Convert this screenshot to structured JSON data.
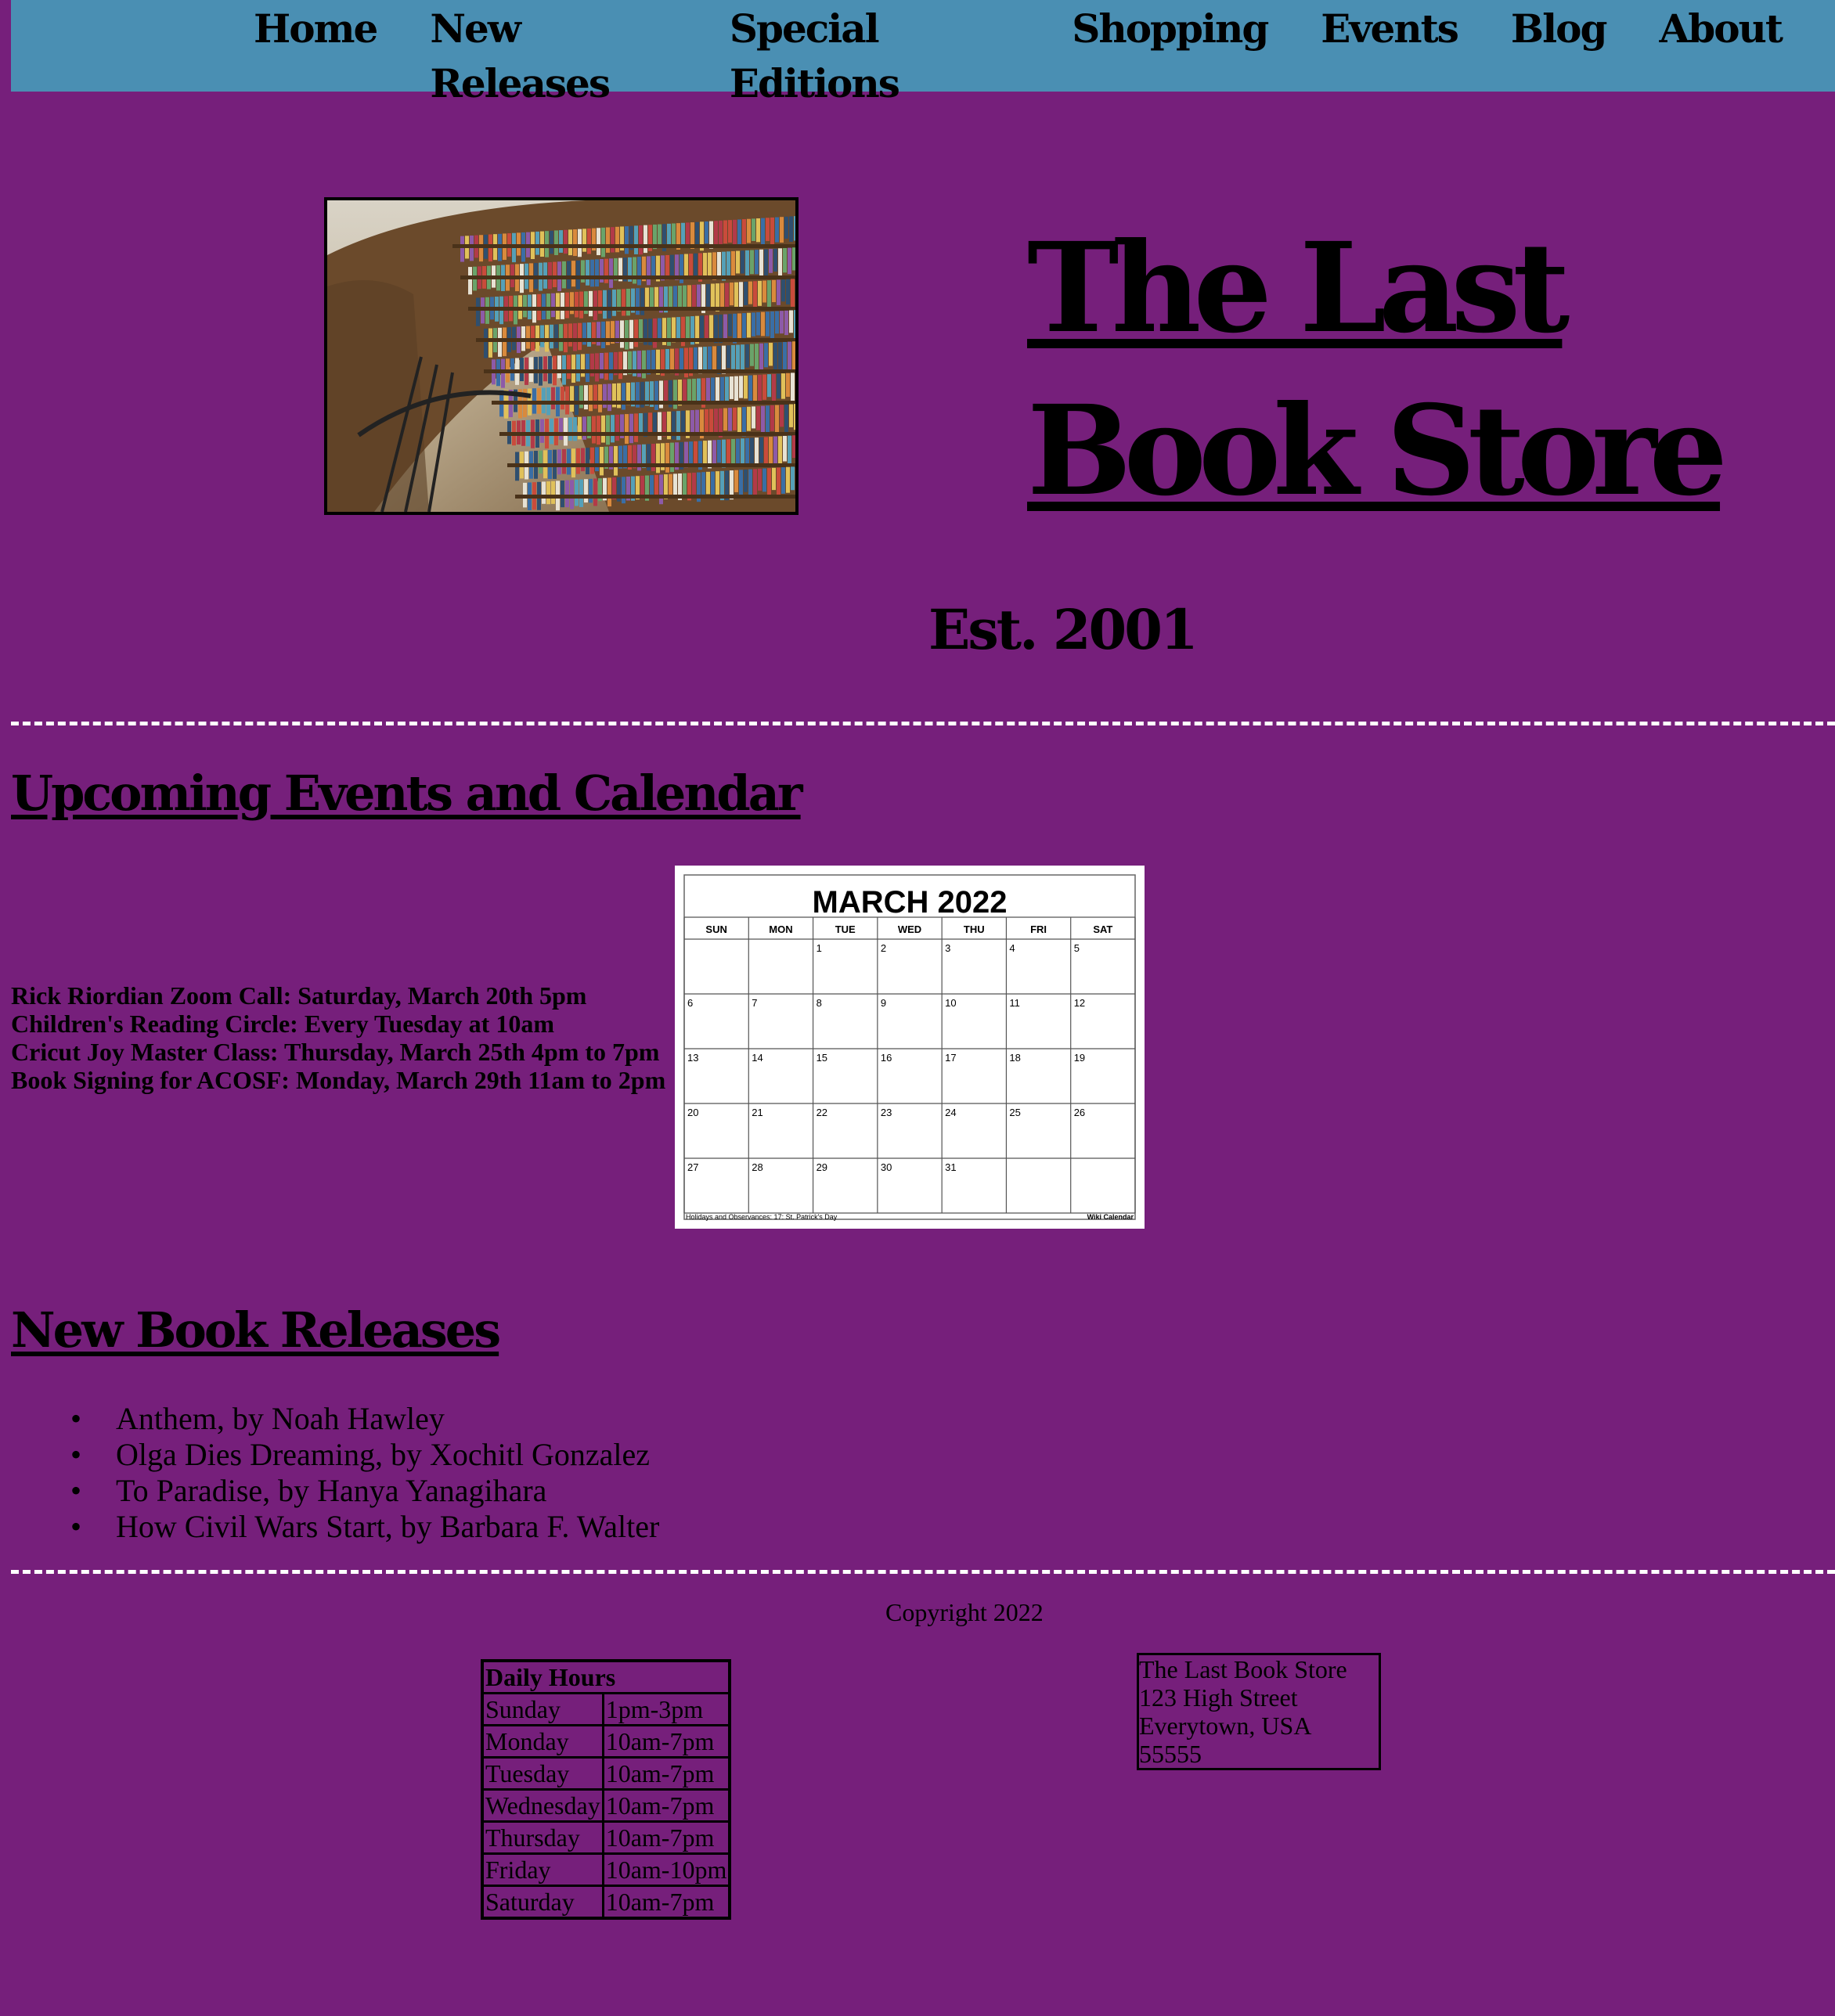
{
  "nav": {
    "items": [
      "Home",
      "New Releases",
      "Special Editions",
      "Shopping",
      "Events",
      "Blog",
      "About"
    ]
  },
  "hero": {
    "title": "The Last Book Store",
    "established": "Est. 2001"
  },
  "events_section": {
    "heading": "Upcoming Events and Calendar",
    "events": [
      "Rick Riordian Zoom Call: Saturday, March 20th 5pm",
      "Children's Reading Circle: Every Tuesday at 10am",
      "Cricut Joy Master Class: Thursday, March 25th 4pm to 7pm",
      "Book Signing for ACOSF: Monday, March 29th 11am to 2pm"
    ],
    "calendar": {
      "title": "MARCH 2022",
      "weekdays": [
        "SUN",
        "MON",
        "TUE",
        "WED",
        "THU",
        "FRI",
        "SAT"
      ],
      "first_weekday_index": 2,
      "days_in_month": 31,
      "footer_left": "Holidays and Observances: 17: St. Patrick's Day",
      "footer_right": "Wiki Calendar"
    }
  },
  "releases_section": {
    "heading": "New Book Releases",
    "items": [
      "Anthem, by Noah Hawley",
      "Olga Dies Dreaming, by Xochitl Gonzalez",
      "To Paradise, by Hanya Yanagihara",
      "How Civil Wars Start, by Barbara F. Walter"
    ]
  },
  "footer": {
    "copyright": "Copyright 2022",
    "hours": {
      "heading": "Daily Hours",
      "rows": [
        {
          "day": "Sunday",
          "time": "1pm-3pm"
        },
        {
          "day": "Monday",
          "time": "10am-7pm"
        },
        {
          "day": "Tuesday",
          "time": "10am-7pm"
        },
        {
          "day": "Wednesday",
          "time": "10am-7pm"
        },
        {
          "day": "Thursday",
          "time": "10am-7pm"
        },
        {
          "day": "Friday",
          "time": "10am-10pm"
        },
        {
          "day": "Saturday",
          "time": "10am-7pm"
        }
      ]
    },
    "address": {
      "name": "The Last Book Store",
      "street": "123 High Street",
      "city": "Everytown, USA 55555"
    }
  },
  "colors": {
    "page_background": "#761f7b",
    "nav_background": "#4a8fb3",
    "divider": "#ffffff"
  }
}
